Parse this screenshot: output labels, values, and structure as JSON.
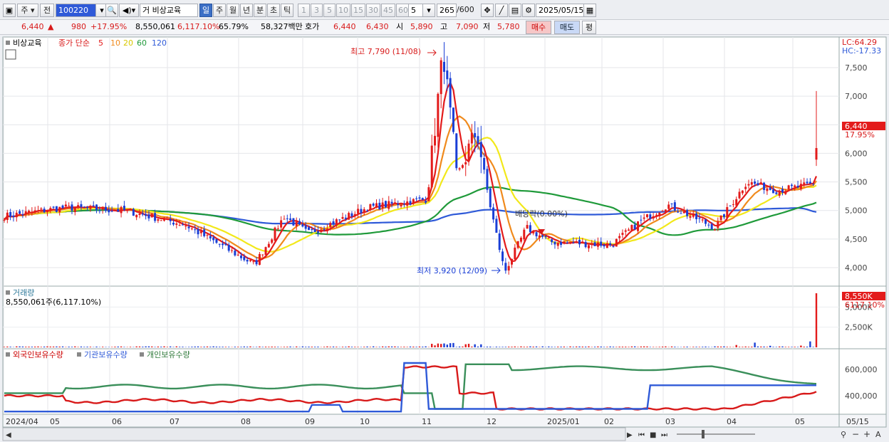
{
  "toolbar": {
    "market": "주",
    "prev": "전",
    "code": "100220",
    "stock_name": "비상교육",
    "periods": [
      "일",
      "주",
      "월",
      "년",
      "분",
      "초",
      "틱"
    ],
    "active_period": "일",
    "intervals": [
      "1",
      "3",
      "5",
      "10",
      "15",
      "30",
      "45",
      "60"
    ],
    "interval_value": "5",
    "count_value": "265",
    "count_total": "/600",
    "date": "2025/05/15"
  },
  "quote": {
    "price": "6,440",
    "change": "980",
    "change_pct": "+17.95%",
    "volume": "8,550,061",
    "volume_ratio": "6,117.10%",
    "turnover": "65.79%",
    "amount": "58,327백만",
    "bid_label": "호가",
    "ask": "6,440",
    "bid": "6,430",
    "open_label": "시",
    "open": "5,890",
    "high_label": "고",
    "high": "7,090",
    "low_label": "저",
    "low": "5,780",
    "buy_label": "매수",
    "sell_label": "매도",
    "avg_label": "평"
  },
  "price_panel": {
    "title": "비상교육",
    "ma_label": "종가 단순",
    "ma_periods": [
      "5",
      "10",
      "20",
      "60",
      "120"
    ],
    "lc": "LC:64.29",
    "hc": "HC:-17.33",
    "high_annotation": "최고 7,790 (11/08)",
    "low_annotation": "최저 3,920 (12/09)",
    "event_annotation": "배당락(0.00%)",
    "last_price": "6,440",
    "last_pct": "17.95%",
    "yticks": [
      "7,500",
      "7,000",
      "6,500",
      "6,000",
      "5,500",
      "5,000",
      "4,500",
      "4,000"
    ]
  },
  "volume_panel": {
    "title": "거래량",
    "legend_value": "8,550,061주(6,117.10%)",
    "last_tag": "8,550K",
    "last_pct": "6117.10%",
    "yticks": [
      "5,000K",
      "2,500K"
    ]
  },
  "holding_panel": {
    "series": [
      "외국인보유수량",
      "기관보유수량",
      "개인보유수량"
    ],
    "yticks": [
      "600,000",
      "400,000"
    ]
  },
  "xaxis": {
    "labels": [
      "2024/04",
      "05",
      "06",
      "07",
      "08",
      "09",
      "10",
      "11",
      "12",
      "2025/01",
      "02",
      "03",
      "04",
      "05",
      "05/15"
    ]
  },
  "colors": {
    "up": "#e31b1b",
    "down": "#1a3fd6",
    "ma5": "#e31b1b",
    "ma10": "#f08a1c",
    "ma20": "#f2e81a",
    "ma60": "#1f9a3a",
    "ma120": "#2f5ad8",
    "foreign": "#d81a1a",
    "inst": "#2f5ad8",
    "retail": "#3a8f5a"
  },
  "chart_data": {
    "type": "line",
    "x_range": [
      "2024/04",
      "2025/05/15"
    ],
    "ylim": [
      3800,
      7900
    ],
    "series": [
      {
        "name": "종가",
        "points": [
          [
            "2024-04",
            4900
          ],
          [
            "2024-05",
            5050
          ],
          [
            "2024-06",
            5000
          ],
          [
            "2024-07",
            4750
          ],
          [
            "2024-08-05",
            4050
          ],
          [
            "2024-08-20",
            4900
          ],
          [
            "2024-09",
            4600
          ],
          [
            "2024-10",
            5050
          ],
          [
            "2024-10-31",
            5200
          ],
          [
            "2024-11-08",
            7790
          ],
          [
            "2024-11-15",
            5600
          ],
          [
            "2024-11-25",
            6400
          ],
          [
            "2024-12-01",
            5200
          ],
          [
            "2024-12-09",
            3920
          ],
          [
            "2024-12-20",
            4700
          ],
          [
            "2025-01",
            4450
          ],
          [
            "2025-02",
            4400
          ],
          [
            "2025-02-15",
            4800
          ],
          [
            "2025-03",
            5100
          ],
          [
            "2025-03-25",
            4700
          ],
          [
            "2025-04-10",
            5500
          ],
          [
            "2025-04-25",
            5350
          ],
          [
            "2025-05-14",
            5460
          ],
          [
            "2025-05-15",
            6440
          ]
        ]
      }
    ],
    "volume_last": 8550061
  }
}
